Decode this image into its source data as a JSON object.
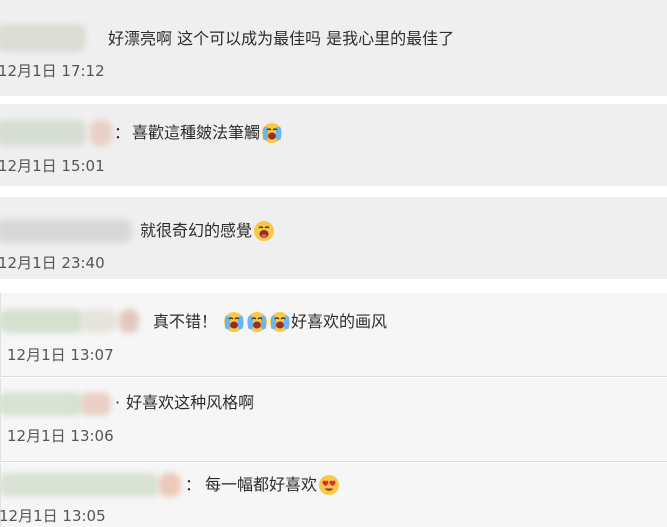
{
  "comments": [
    {
      "text": "好漂亮啊 这个可以成为最佳吗 是我心里的最佳了",
      "time": "12月1日 17:12"
    },
    {
      "separator": "：",
      "text": "喜歡這種皴法筆觸",
      "time": "12月1日 15:01",
      "emoji": "crying-face-icon"
    },
    {
      "text": "就很奇幻的感覺",
      "time": "12月1日 23:40",
      "emoji": "grinning-face-icon"
    },
    {
      "text_before": "真不错！",
      "text_after": "好喜欢的画风",
      "time": "12月1日 13:07",
      "emoji": "crying-face-icon"
    },
    {
      "separator": "·",
      "text": "好喜欢这种风格啊",
      "time": "12月1日 13:06"
    },
    {
      "separator": "：",
      "text": "每一幅都好喜欢",
      "time": "12月1日 13:05",
      "emoji": "heart-eyes-face-icon"
    }
  ]
}
